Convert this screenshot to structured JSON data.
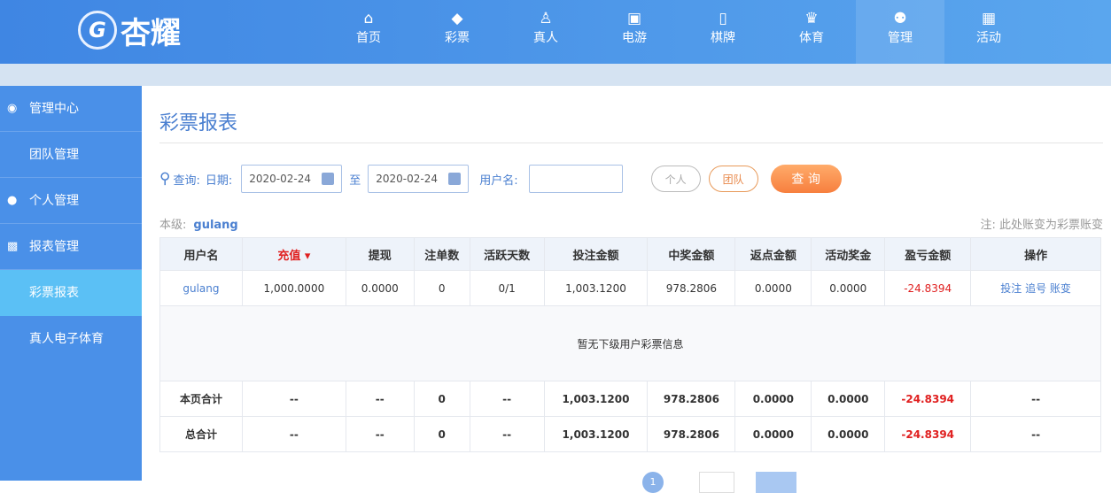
{
  "logo": {
    "text": "杏耀",
    "mark": "G"
  },
  "nav": [
    {
      "label": "首页",
      "icon": "⌂"
    },
    {
      "label": "彩票",
      "icon": "◆"
    },
    {
      "label": "真人",
      "icon": "♙"
    },
    {
      "label": "电游",
      "icon": "▣"
    },
    {
      "label": "棋牌",
      "icon": "▯"
    },
    {
      "label": "体育",
      "icon": "♛"
    },
    {
      "label": "管理",
      "icon": "⚉"
    },
    {
      "label": "活动",
      "icon": "▦"
    }
  ],
  "sidebar": {
    "items": [
      "管理中心",
      "团队管理",
      "个人管理",
      "报表管理",
      "彩票报表",
      "真人电子体育"
    ]
  },
  "page": {
    "title": "彩票报表"
  },
  "query": {
    "label": "查询:",
    "date_label": "日期:",
    "from": "2020-02-24",
    "to_label": "至",
    "to": "2020-02-24",
    "user_label": "用户名:",
    "user_value": "",
    "personal": "个人",
    "team": "团队",
    "submit": "查 询"
  },
  "level": {
    "label": "本级:",
    "user": "gulang"
  },
  "note": "注: 此处账变为彩票账变",
  "table": {
    "headers": [
      "用户名",
      "充值",
      "提现",
      "注单数",
      "活跃天数",
      "投注金额",
      "中奖金额",
      "返点金额",
      "活动奖金",
      "盈亏金额",
      "操作"
    ],
    "row": [
      "gulang",
      "1,000.0000",
      "0.0000",
      "0",
      "0/1",
      "1,003.1200",
      "978.2806",
      "0.0000",
      "0.0000",
      "-24.8394"
    ],
    "actions": [
      "投注",
      "追号",
      "账变"
    ],
    "empty": "暂无下级用户彩票信息",
    "page_total": [
      "本页合计",
      "--",
      "--",
      "0",
      "--",
      "1,003.1200",
      "978.2806",
      "0.0000",
      "0.0000",
      "-24.8394",
      "--"
    ],
    "grand_total": [
      "总合计",
      "--",
      "--",
      "0",
      "--",
      "1,003.1200",
      "978.2806",
      "0.0000",
      "0.0000",
      "-24.8394",
      "--"
    ]
  },
  "pagination": {
    "current": "1"
  }
}
